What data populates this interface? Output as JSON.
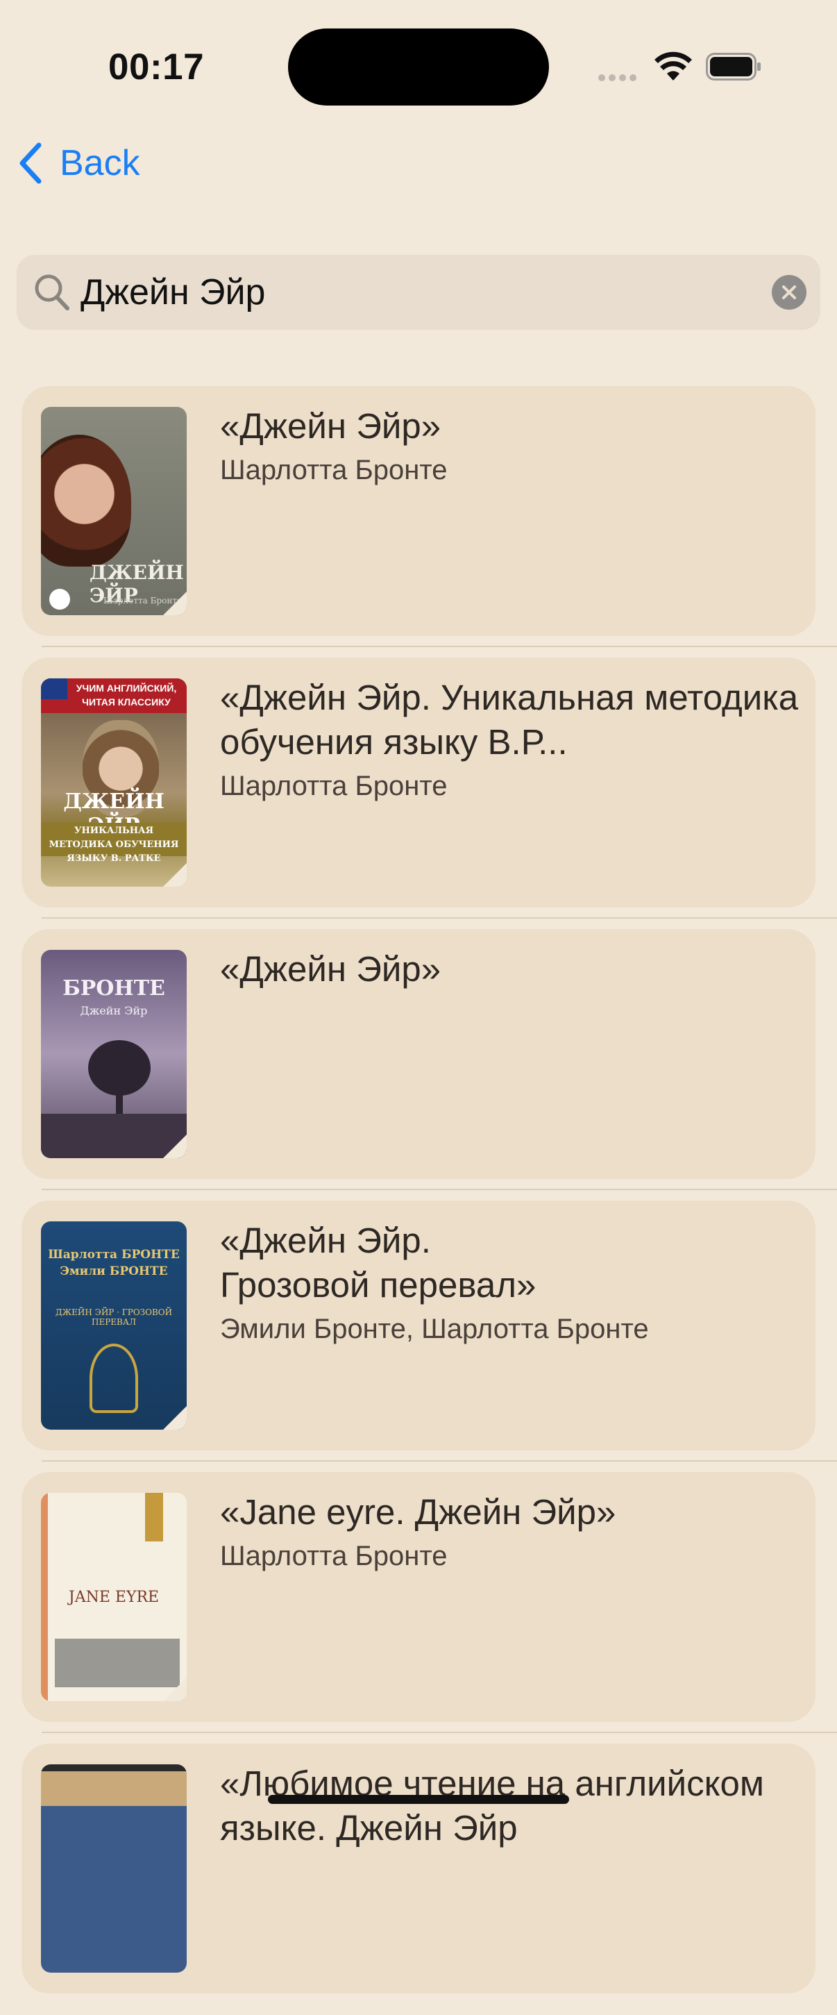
{
  "status_bar": {
    "time": "00:17"
  },
  "nav": {
    "back_label": "Back"
  },
  "search": {
    "value": "Джейн Эйр"
  },
  "results": [
    {
      "title": "«Джейн Эйр»",
      "author": "Шарлотта Бронте",
      "cover_text": "ДЖЕЙН ЭЙР",
      "cover_subtext": "Шарлотта Бронте"
    },
    {
      "title": "«Джейн Эйр. Уникальная методика обучения языку В.Р...",
      "author": "Шарлотта Бронте",
      "cover_text": "ДЖЕЙН ЭЙР",
      "cover_banner": "УЧИМ АНГЛИЙСКИЙ, ЧИТАЯ КЛАССИКУ",
      "cover_subtext": "УНИКАЛЬНАЯ МЕТОДИКА ОБУЧЕНИЯ ЯЗЫКУ В. РАТКЕ"
    },
    {
      "title": "«Джейн Эйр»",
      "author": "",
      "cover_text": "БРОНТЕ",
      "cover_subtext": "Джейн Эйр"
    },
    {
      "title": "«Джейн Эйр. Грозовой перевал»",
      "author": "Эмили Бронте, Шарлотта Бронте",
      "cover_text": "Шарлотта БРОНТЕ Эмили БРОНТЕ",
      "cover_subtext": "ДЖЕЙН ЭЙР · ГРОЗОВОЙ ПЕРЕВАЛ"
    },
    {
      "title": "«Jane eyre. Джейн Эйр»",
      "author": "Шарлотта Бронте",
      "cover_text": "JANE EYRE"
    },
    {
      "title": "«Любимое чтение на английском языке. Джейн Эйр",
      "author": ""
    }
  ]
}
